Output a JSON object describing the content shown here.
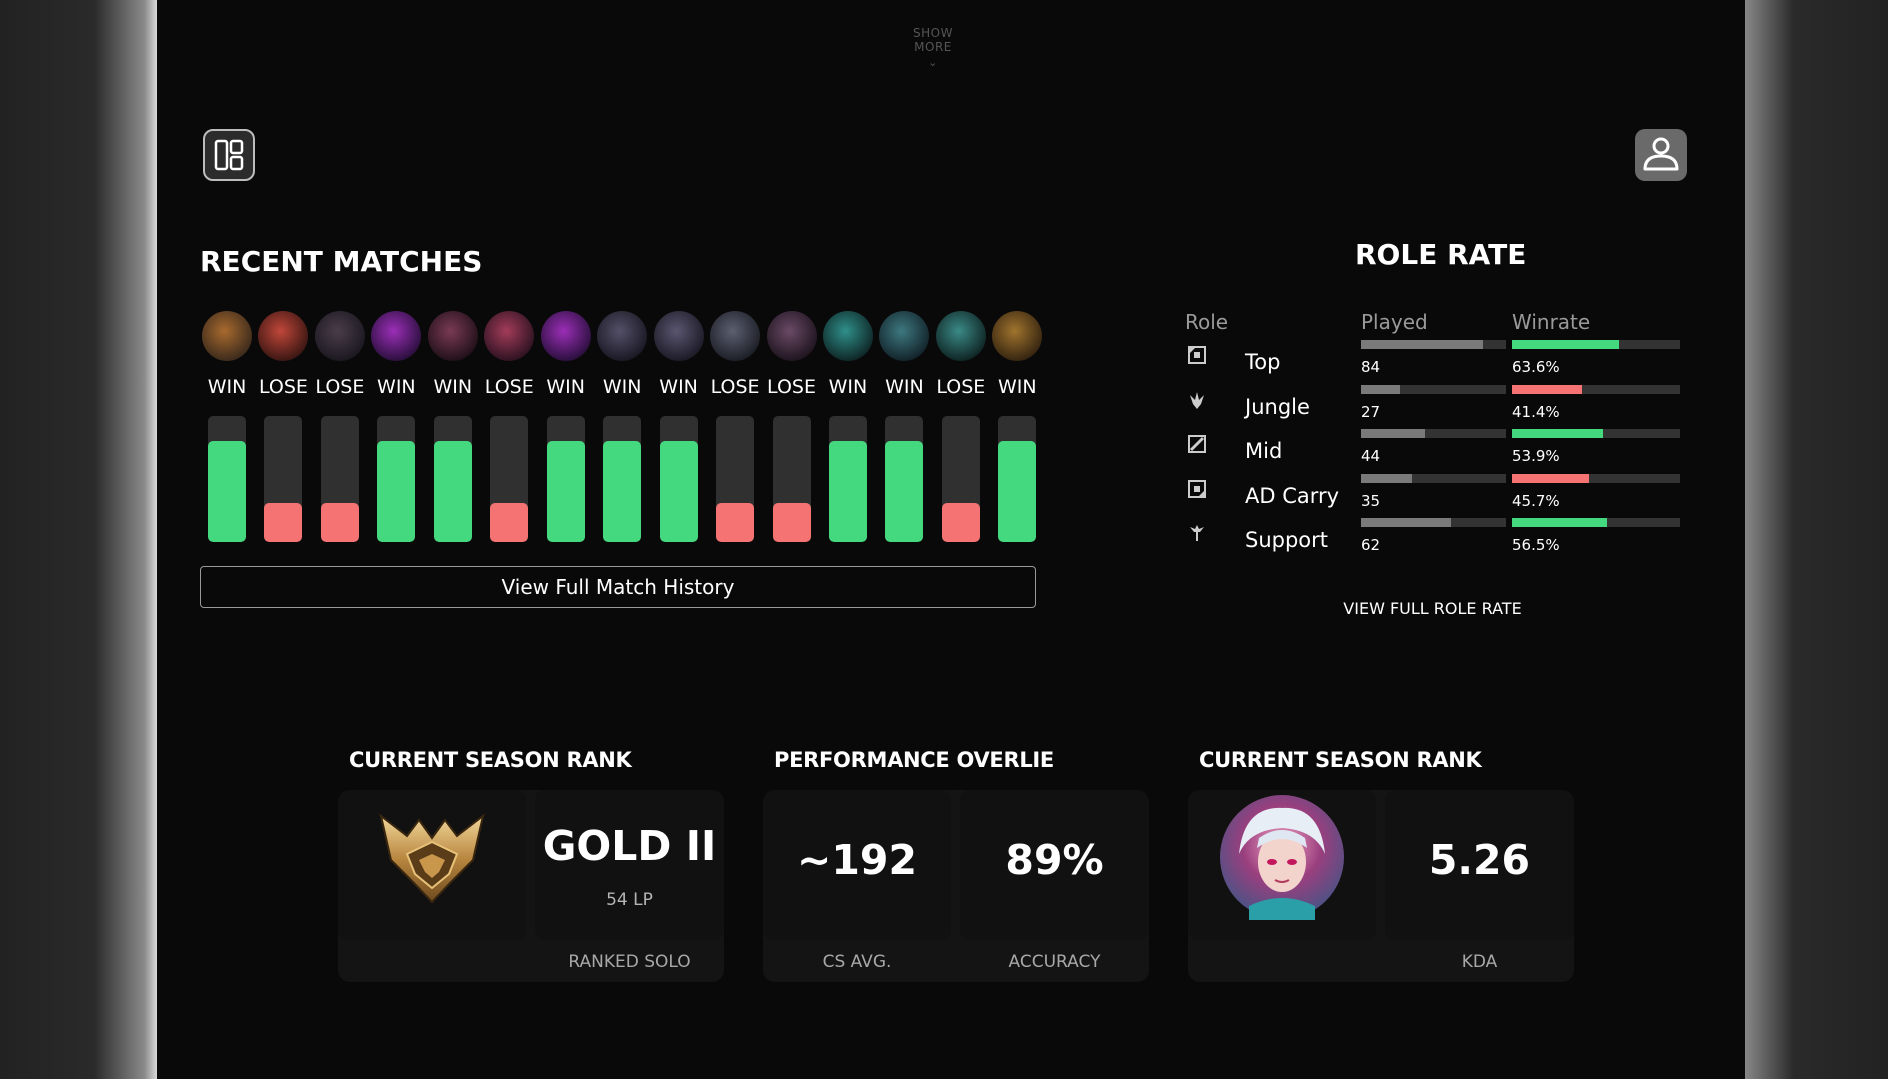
{
  "show_more": {
    "label": "SHOW MORE"
  },
  "recent_matches": {
    "title": "RECENT MATCHES",
    "results": [
      "WIN",
      "LOSE",
      "LOSE",
      "WIN",
      "WIN",
      "LOSE",
      "WIN",
      "WIN",
      "WIN",
      "LOSE",
      "LOSE",
      "WIN",
      "WIN",
      "LOSE",
      "WIN"
    ],
    "history_button": "View Full Match History"
  },
  "role_rate": {
    "title": "ROLE RATE",
    "headers": {
      "role": "Role",
      "played": "Played",
      "winrate": "Winrate"
    },
    "roles": [
      {
        "name": "Top",
        "played": "84",
        "played_frac": 0.84,
        "winrate": "63.6%",
        "winrate_frac": 0.636,
        "color": "#45d97f",
        "icon": "top-lane-icon"
      },
      {
        "name": "Jungle",
        "played": "27",
        "played_frac": 0.27,
        "winrate": "41.4%",
        "winrate_frac": 0.414,
        "color": "#f57373",
        "icon": "jungle-icon"
      },
      {
        "name": "Mid",
        "played": "44",
        "played_frac": 0.44,
        "winrate": "53.9%",
        "winrate_frac": 0.539,
        "color": "#45d97f",
        "icon": "mid-lane-icon"
      },
      {
        "name": "AD Carry",
        "played": "35",
        "played_frac": 0.35,
        "winrate": "45.7%",
        "winrate_frac": 0.457,
        "color": "#f57373",
        "icon": "bot-lane-icon"
      },
      {
        "name": "Support",
        "played": "62",
        "played_frac": 0.62,
        "winrate": "56.5%",
        "winrate_frac": 0.565,
        "color": "#45d97f",
        "icon": "support-icon"
      }
    ],
    "view_link": "VIEW FULL ROLE RATE"
  },
  "rank_card": {
    "title": "CURRENT SEASON RANK",
    "tier": "GOLD II",
    "lp": "54 LP",
    "queue": "RANKED SOLO"
  },
  "performance_card": {
    "title": "PERFORMANCE OVERLIE",
    "cs_value": "~192",
    "cs_label": "CS AVG.",
    "accuracy_value": "89%",
    "accuracy_label": "ACCURACY"
  },
  "kda_card": {
    "title": "CURRENT SEASON RANK",
    "kda_value": "5.26",
    "kda_label": "KDA"
  },
  "colors": {
    "win": "#45d97f",
    "lose": "#f57373",
    "track": "#303030",
    "played_bar": "#7a7a7a"
  }
}
